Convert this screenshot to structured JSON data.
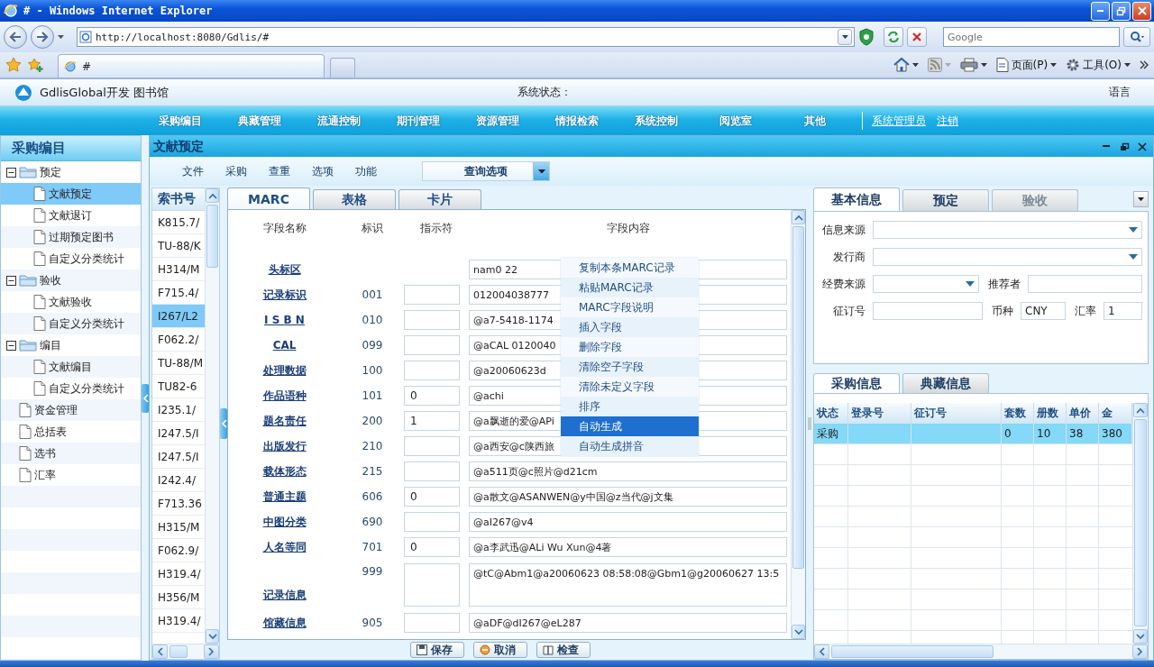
{
  "browser": {
    "title": "# - Windows Internet Explorer",
    "address": "http://localhost:8080/Gdlis/#",
    "search_placeholder": "Google",
    "tab": "#",
    "page_menu": "页面(P)",
    "tools_menu": "工具(O)"
  },
  "app": {
    "name": "GdlisGlobal开发 图书馆",
    "status_label": "系统状态：",
    "language": "语言"
  },
  "nav": {
    "items": [
      "采购编目",
      "典藏管理",
      "流通控制",
      "期刊管理",
      "资源管理",
      "情报检索",
      "系统控制",
      "阅览室",
      "其他"
    ],
    "user": "系统管理员",
    "logout": "注销"
  },
  "sidebar": {
    "title": "采购编目",
    "items": [
      {
        "kind": "folder",
        "label": "预定",
        "expanded": true,
        "selected": false,
        "children": [
          {
            "label": "文献预定",
            "selected": true
          },
          {
            "label": "文献退订",
            "selected": false
          },
          {
            "label": "过期预定图书",
            "selected": false
          },
          {
            "label": "自定义分类统计",
            "selected": false
          }
        ]
      },
      {
        "kind": "folder",
        "label": "验收",
        "expanded": true,
        "selected": false,
        "children": [
          {
            "label": "文献验收",
            "selected": false
          },
          {
            "label": "自定义分类统计",
            "selected": false
          }
        ]
      },
      {
        "kind": "folder",
        "label": "编目",
        "expanded": true,
        "selected": false,
        "children": [
          {
            "label": "文献编目",
            "selected": false
          },
          {
            "label": "自定义分类统计",
            "selected": false
          }
        ]
      },
      {
        "kind": "page",
        "label": "资金管理",
        "selected": false
      },
      {
        "kind": "page",
        "label": "总括表",
        "selected": false
      },
      {
        "kind": "page",
        "label": "选书",
        "selected": false
      },
      {
        "kind": "page",
        "label": "汇率",
        "selected": false
      }
    ]
  },
  "panel": {
    "title": "文献预定",
    "menu": [
      "文件",
      "采购",
      "查重",
      "选项",
      "功能"
    ],
    "query": "查询选项"
  },
  "call_numbers": {
    "header": "索书号",
    "items": [
      {
        "text": "K815.7/",
        "selected": false
      },
      {
        "text": "TU-88/K",
        "selected": false
      },
      {
        "text": "H314/M",
        "selected": false
      },
      {
        "text": "F715.4/",
        "selected": false
      },
      {
        "text": "I267/L2",
        "selected": true
      },
      {
        "text": "F062.2/",
        "selected": false
      },
      {
        "text": "TU-88/M",
        "selected": false
      },
      {
        "text": "TU82-6",
        "selected": false
      },
      {
        "text": "I235.1/",
        "selected": false
      },
      {
        "text": "I247.5/I",
        "selected": false
      },
      {
        "text": "I247.5/I",
        "selected": false
      },
      {
        "text": "I242.4/",
        "selected": false
      },
      {
        "text": "F713.36",
        "selected": false
      },
      {
        "text": "H315/M",
        "selected": false
      },
      {
        "text": "F062.9/",
        "selected": false
      },
      {
        "text": "H319.4/",
        "selected": false
      },
      {
        "text": "H356/M",
        "selected": false
      },
      {
        "text": "H319.4/",
        "selected": false
      }
    ]
  },
  "marc": {
    "tabs": [
      {
        "label": "MARC",
        "selected": true
      },
      {
        "label": "表格",
        "selected": false
      },
      {
        "label": "卡片",
        "selected": false
      }
    ],
    "columns": [
      "字段名称",
      "标识",
      "指示符",
      "字段内容"
    ],
    "rows": [
      {
        "kind": "leader",
        "name": "头标区",
        "content": "nam0 22"
      },
      {
        "kind": "field",
        "name": "记录标识",
        "tag": "001",
        "content": "012004038777"
      },
      {
        "kind": "field",
        "name": "I S B N",
        "tag": "010",
        "content": "@a7-5418-1174"
      },
      {
        "kind": "field",
        "name": "CAL",
        "tag": "099",
        "content": "@aCAL 0120040"
      },
      {
        "kind": "field",
        "name": "处理数据",
        "tag": "100",
        "content": "@a20060623d"
      },
      {
        "kind": "field",
        "name": "作品语种",
        "tag": "101",
        "indicator": "0",
        "content": "@achi"
      },
      {
        "kind": "field",
        "name": "题名责任",
        "tag": "200",
        "indicator": "1",
        "content": "@a飘逝的爱@APi"
      },
      {
        "kind": "field",
        "name": "出版发行",
        "tag": "210",
        "content": "@a西安@c陕西旅"
      },
      {
        "kind": "field",
        "name": "载体形态",
        "tag": "215",
        "content": "@a511页@c照片@d21cm"
      },
      {
        "kind": "field",
        "name": "普通主题",
        "tag": "606",
        "indicator": "0",
        "content": "@a散文@ASANWEN@y中国@z当代@j文集"
      },
      {
        "kind": "field",
        "name": "中图分类",
        "tag": "690",
        "content": "@aI267@v4"
      },
      {
        "kind": "field",
        "name": "人名等同",
        "tag": "701",
        "indicator": "0",
        "content": "@a李武迅@ALi Wu Xun@4著"
      },
      {
        "kind": "multiline",
        "name": "记录信息",
        "tag": "999",
        "content": "@tC@Abm1@a20060623 08:58:08@Gbm1@g20060627 13:5"
      },
      {
        "kind": "field",
        "name": "馆藏信息",
        "tag": "905",
        "content": "@aDF@dI267@eL287"
      }
    ],
    "buttons": [
      "保存",
      "取消",
      "检查"
    ]
  },
  "context_menu": {
    "items": [
      {
        "label": "复制本条MARC记录",
        "selected": false
      },
      {
        "label": "粘贴MARC记录",
        "selected": false
      },
      {
        "label": "MARC字段说明",
        "selected": false
      },
      {
        "label": "插入字段",
        "selected": false
      },
      {
        "label": "删除字段",
        "selected": false
      },
      {
        "label": "清除空子字段",
        "selected": false
      },
      {
        "label": "清除未定义字段",
        "selected": false
      },
      {
        "label": "排序",
        "selected": false
      },
      {
        "label": "自动生成",
        "selected": true
      },
      {
        "label": "自动生成拼音",
        "selected": false
      }
    ]
  },
  "info": {
    "tabs": [
      {
        "label": "基本信息",
        "selected": true,
        "disabled": false
      },
      {
        "label": "预定",
        "selected": false,
        "disabled": false
      },
      {
        "label": "验收",
        "selected": false,
        "disabled": true
      }
    ],
    "rows": [
      [
        {
          "label": "信息来源",
          "kind": "select"
        }
      ],
      [
        {
          "label": "发行商",
          "kind": "select"
        }
      ],
      [
        {
          "label": "经费来源",
          "kind": "select"
        },
        {
          "label": "推荐者",
          "kind": "text"
        }
      ],
      [
        {
          "label": "征订号",
          "kind": "text"
        },
        {
          "label": "币种",
          "kind": "text",
          "value": "CNY"
        },
        {
          "label": "汇率",
          "kind": "text",
          "value": "1"
        }
      ]
    ]
  },
  "orders": {
    "tabs": [
      {
        "label": "采购信息",
        "selected": true
      },
      {
        "label": "典藏信息",
        "selected": false
      }
    ],
    "columns": [
      "状态",
      "登录号",
      "征订号",
      "套数",
      "册数",
      "单价",
      "金"
    ],
    "rows": [
      {
        "selected": true,
        "cells": [
          "采购",
          null,
          null,
          "0",
          "10",
          "38",
          "380"
        ]
      }
    ]
  }
}
